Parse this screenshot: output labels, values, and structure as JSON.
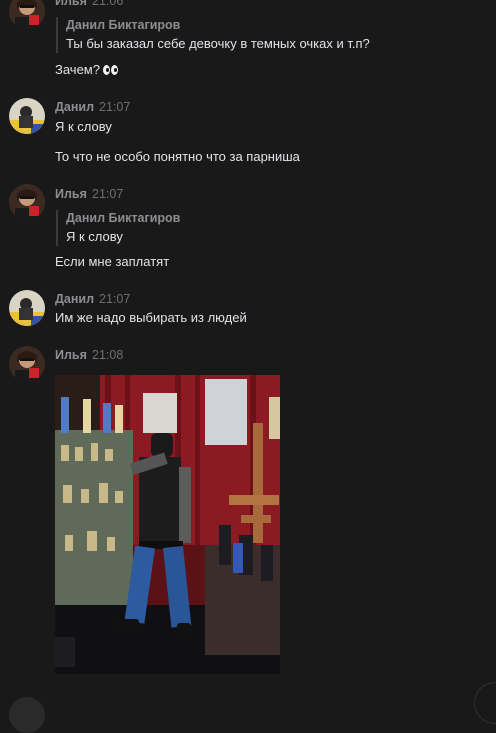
{
  "messages": [
    {
      "author": "Илья",
      "time": "21:06",
      "quote": {
        "author": "Данил Биктагиров",
        "text": "Ты бы заказал себе девочку в темных очках и т.п?"
      },
      "lines": [
        "Зачем?"
      ],
      "emoji": "eyes-emoji"
    },
    {
      "author": "Данил",
      "time": "21:07",
      "lines": [
        "Я к слову",
        "То что не особо понятно что за парниша"
      ]
    },
    {
      "author": "Илья",
      "time": "21:07",
      "quote": {
        "author": "Данил Биктагиров",
        "text": "Я к слову"
      },
      "lines": [
        "Если мне заплатят"
      ]
    },
    {
      "author": "Данил",
      "time": "21:07",
      "lines": [
        "Им же надо выбирать из людей"
      ]
    },
    {
      "author": "Илья",
      "time": "21:08",
      "attachment": "photo"
    }
  ],
  "colors": {
    "background": "#19191a",
    "text": "#e1e3e6",
    "author": "#8d8e91",
    "time": "#6d6f72",
    "quote_bar": "#3a3b3d"
  }
}
